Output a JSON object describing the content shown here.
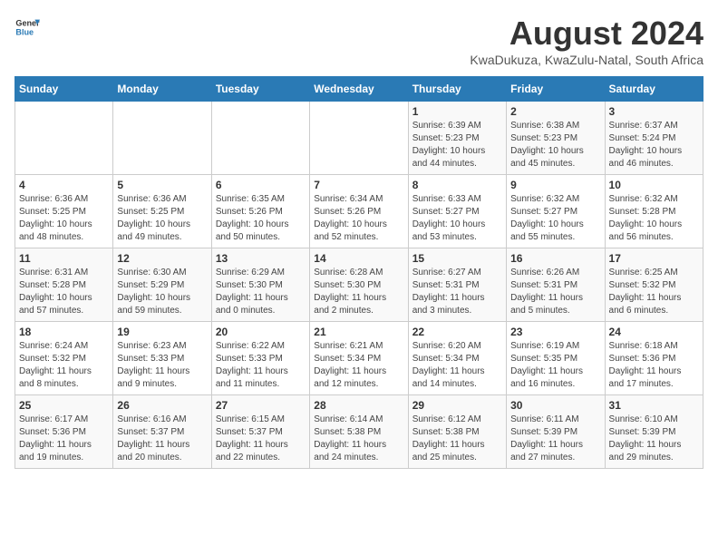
{
  "logo": {
    "general": "General",
    "blue": "Blue"
  },
  "title": {
    "month": "August 2024",
    "location": "KwaDukuza, KwaZulu-Natal, South Africa"
  },
  "headers": [
    "Sunday",
    "Monday",
    "Tuesday",
    "Wednesday",
    "Thursday",
    "Friday",
    "Saturday"
  ],
  "weeks": [
    [
      {
        "day": "",
        "info": ""
      },
      {
        "day": "",
        "info": ""
      },
      {
        "day": "",
        "info": ""
      },
      {
        "day": "",
        "info": ""
      },
      {
        "day": "1",
        "info": "Sunrise: 6:39 AM\nSunset: 5:23 PM\nDaylight: 10 hours\nand 44 minutes."
      },
      {
        "day": "2",
        "info": "Sunrise: 6:38 AM\nSunset: 5:23 PM\nDaylight: 10 hours\nand 45 minutes."
      },
      {
        "day": "3",
        "info": "Sunrise: 6:37 AM\nSunset: 5:24 PM\nDaylight: 10 hours\nand 46 minutes."
      }
    ],
    [
      {
        "day": "4",
        "info": "Sunrise: 6:36 AM\nSunset: 5:25 PM\nDaylight: 10 hours\nand 48 minutes."
      },
      {
        "day": "5",
        "info": "Sunrise: 6:36 AM\nSunset: 5:25 PM\nDaylight: 10 hours\nand 49 minutes."
      },
      {
        "day": "6",
        "info": "Sunrise: 6:35 AM\nSunset: 5:26 PM\nDaylight: 10 hours\nand 50 minutes."
      },
      {
        "day": "7",
        "info": "Sunrise: 6:34 AM\nSunset: 5:26 PM\nDaylight: 10 hours\nand 52 minutes."
      },
      {
        "day": "8",
        "info": "Sunrise: 6:33 AM\nSunset: 5:27 PM\nDaylight: 10 hours\nand 53 minutes."
      },
      {
        "day": "9",
        "info": "Sunrise: 6:32 AM\nSunset: 5:27 PM\nDaylight: 10 hours\nand 55 minutes."
      },
      {
        "day": "10",
        "info": "Sunrise: 6:32 AM\nSunset: 5:28 PM\nDaylight: 10 hours\nand 56 minutes."
      }
    ],
    [
      {
        "day": "11",
        "info": "Sunrise: 6:31 AM\nSunset: 5:28 PM\nDaylight: 10 hours\nand 57 minutes."
      },
      {
        "day": "12",
        "info": "Sunrise: 6:30 AM\nSunset: 5:29 PM\nDaylight: 10 hours\nand 59 minutes."
      },
      {
        "day": "13",
        "info": "Sunrise: 6:29 AM\nSunset: 5:30 PM\nDaylight: 11 hours\nand 0 minutes."
      },
      {
        "day": "14",
        "info": "Sunrise: 6:28 AM\nSunset: 5:30 PM\nDaylight: 11 hours\nand 2 minutes."
      },
      {
        "day": "15",
        "info": "Sunrise: 6:27 AM\nSunset: 5:31 PM\nDaylight: 11 hours\nand 3 minutes."
      },
      {
        "day": "16",
        "info": "Sunrise: 6:26 AM\nSunset: 5:31 PM\nDaylight: 11 hours\nand 5 minutes."
      },
      {
        "day": "17",
        "info": "Sunrise: 6:25 AM\nSunset: 5:32 PM\nDaylight: 11 hours\nand 6 minutes."
      }
    ],
    [
      {
        "day": "18",
        "info": "Sunrise: 6:24 AM\nSunset: 5:32 PM\nDaylight: 11 hours\nand 8 minutes."
      },
      {
        "day": "19",
        "info": "Sunrise: 6:23 AM\nSunset: 5:33 PM\nDaylight: 11 hours\nand 9 minutes."
      },
      {
        "day": "20",
        "info": "Sunrise: 6:22 AM\nSunset: 5:33 PM\nDaylight: 11 hours\nand 11 minutes."
      },
      {
        "day": "21",
        "info": "Sunrise: 6:21 AM\nSunset: 5:34 PM\nDaylight: 11 hours\nand 12 minutes."
      },
      {
        "day": "22",
        "info": "Sunrise: 6:20 AM\nSunset: 5:34 PM\nDaylight: 11 hours\nand 14 minutes."
      },
      {
        "day": "23",
        "info": "Sunrise: 6:19 AM\nSunset: 5:35 PM\nDaylight: 11 hours\nand 16 minutes."
      },
      {
        "day": "24",
        "info": "Sunrise: 6:18 AM\nSunset: 5:36 PM\nDaylight: 11 hours\nand 17 minutes."
      }
    ],
    [
      {
        "day": "25",
        "info": "Sunrise: 6:17 AM\nSunset: 5:36 PM\nDaylight: 11 hours\nand 19 minutes."
      },
      {
        "day": "26",
        "info": "Sunrise: 6:16 AM\nSunset: 5:37 PM\nDaylight: 11 hours\nand 20 minutes."
      },
      {
        "day": "27",
        "info": "Sunrise: 6:15 AM\nSunset: 5:37 PM\nDaylight: 11 hours\nand 22 minutes."
      },
      {
        "day": "28",
        "info": "Sunrise: 6:14 AM\nSunset: 5:38 PM\nDaylight: 11 hours\nand 24 minutes."
      },
      {
        "day": "29",
        "info": "Sunrise: 6:12 AM\nSunset: 5:38 PM\nDaylight: 11 hours\nand 25 minutes."
      },
      {
        "day": "30",
        "info": "Sunrise: 6:11 AM\nSunset: 5:39 PM\nDaylight: 11 hours\nand 27 minutes."
      },
      {
        "day": "31",
        "info": "Sunrise: 6:10 AM\nSunset: 5:39 PM\nDaylight: 11 hours\nand 29 minutes."
      }
    ]
  ]
}
